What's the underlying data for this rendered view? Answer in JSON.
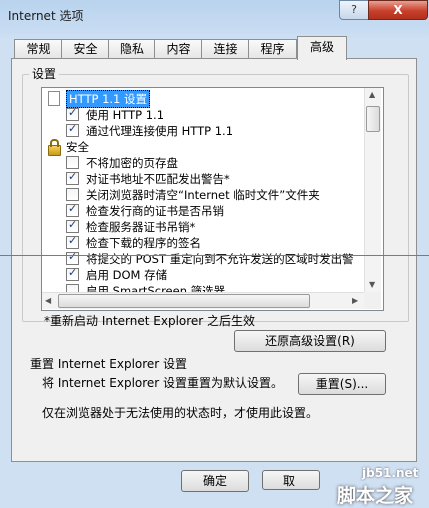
{
  "window": {
    "title": "Internet 选项",
    "help": "?",
    "close": "X"
  },
  "tabs": [
    "常规",
    "安全",
    "隐私",
    "内容",
    "连接",
    "程序",
    "高级"
  ],
  "settings": {
    "group_label": "设置",
    "items": [
      {
        "type": "category",
        "label": "HTTP 1.1 设置",
        "icon": "page-icon"
      },
      {
        "type": "check",
        "label": "使用 HTTP 1.1",
        "checked": true
      },
      {
        "type": "check",
        "label": "通过代理连接使用 HTTP 1.1",
        "checked": true
      },
      {
        "type": "category",
        "label": "安全",
        "icon": "lock-icon"
      },
      {
        "type": "check",
        "label": "不将加密的页存盘",
        "checked": false
      },
      {
        "type": "check",
        "label": "对证书地址不匹配发出警告*",
        "checked": true
      },
      {
        "type": "check",
        "label": "关闭浏览器时清空“Internet 临时文件”文件夹",
        "checked": false
      },
      {
        "type": "check",
        "label": "检查发行商的证书是否吊销",
        "checked": true
      },
      {
        "type": "check",
        "label": "检查服务器证书吊销*",
        "checked": true
      },
      {
        "type": "check",
        "label": "检查下载的程序的签名",
        "checked": true
      },
      {
        "type": "check",
        "label": "将提交的 POST 重定向到不允许发送的区域时发出警",
        "checked": true
      },
      {
        "type": "check",
        "label": "启用 DOM 存储",
        "checked": true
      },
      {
        "type": "check",
        "label": "启用 SmartScreen 筛选器",
        "checked": false
      }
    ],
    "restart_note": "*重新启动 Internet Explorer 之后生效",
    "restore_button": "还原高级设置(R)"
  },
  "reset": {
    "heading": "重置 Internet Explorer 设置",
    "desc": "将 Internet Explorer 设置重置为默认设置。",
    "button": "重置(S)...",
    "note": "仅在浏览器处于无法使用的状态时，才使用此设置。"
  },
  "footer": {
    "ok": "确定",
    "cancel": "取"
  },
  "watermark": {
    "site": "jb51.net",
    "brand": "脚本之家"
  },
  "colors": {
    "title_bg": "#b9d3ee",
    "close_bg": "#c8402b",
    "selected_row": "#3399ff"
  }
}
